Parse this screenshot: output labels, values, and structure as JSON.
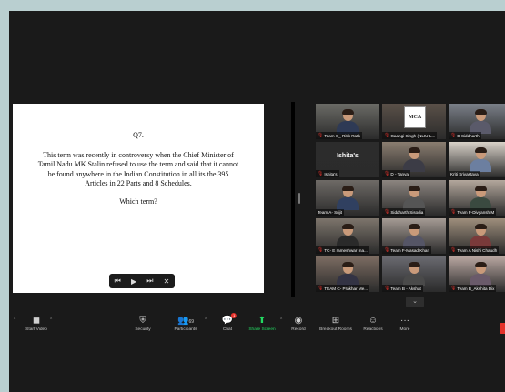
{
  "slide": {
    "question_number": "Q7.",
    "body": "This term was recently in controversy when the Chief Minister of Tamil Nadu MK Stalin refused to use the term and said that it cannot be found anywhere in the Indian Constitution in all its the 395 Articles in 22 Parts and 8 Schedules.",
    "prompt": "Which term?",
    "controls": {
      "prev": "⏮",
      "play": "▶",
      "next": "⏭",
      "close": "✕"
    }
  },
  "gallery": {
    "tiles": [
      {
        "label": "Team C_ Ritik Rath",
        "muted": true
      },
      {
        "label": "Gaangi Singh (NLIU-L...",
        "muted": true,
        "logo": "MCA"
      },
      {
        "label": "D Siddharth",
        "muted": true
      },
      {
        "label": "Ishita's",
        "muted": true,
        "avatar": "Ishita's"
      },
      {
        "label": "D - Tanya",
        "muted": true
      },
      {
        "label": "Kriti Srivastava",
        "muted": false
      },
      {
        "label": "Team A- Srijit",
        "muted": false
      },
      {
        "label": "Siddharth Sisodia",
        "muted": true
      },
      {
        "label": "Team F-Divyansh M",
        "muted": true
      },
      {
        "label": "TC- E rameshwar ma...",
        "muted": true
      },
      {
        "label": "Team F-Masad Khan",
        "muted": true
      },
      {
        "label": "Team A Nishi Chaudh",
        "muted": true
      },
      {
        "label": "TEAM C- Prakhar Me...",
        "muted": true
      },
      {
        "label": "Team B - Akshat",
        "muted": true
      },
      {
        "label": "Team B_Akshita Dix",
        "muted": true
      }
    ],
    "next_icon": "chevron-down"
  },
  "toolbar": {
    "start_video": "Start Video",
    "security": "Security",
    "participants": "Participants",
    "participants_count": "69",
    "chat": "Chat",
    "chat_badge": "1",
    "share_screen": "Share Screen",
    "record": "Record",
    "breakout_rooms": "Breakout Rooms",
    "reactions": "Reactions",
    "more": "More"
  },
  "colors": {
    "accent_green": "#23d962",
    "alert_red": "#e5302a"
  }
}
